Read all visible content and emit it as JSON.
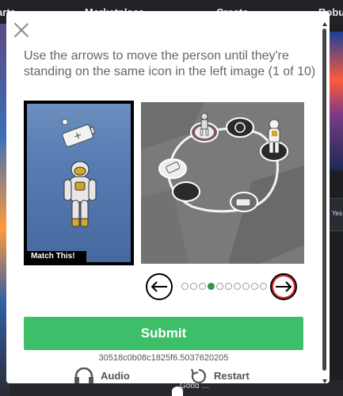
{
  "background": {
    "nav_items": [
      "arts",
      "Marketplace",
      "Create",
      "Robux"
    ],
    "right_text": "Yes",
    "bottom_text": "Good …"
  },
  "modal": {
    "instructions": "Use the arrows to move the person until they're standing on the same icon in the left image (1 of 10)",
    "target_label": "Match This!",
    "submit_label": "Submit",
    "session_id": "30518c0b08c1825f6.5037620205",
    "audio_label": "Audio",
    "restart_label": "Restart",
    "progress": {
      "current_page": 4,
      "total_pages": 10
    }
  },
  "colors": {
    "submit": "#3dbf6a",
    "active_dot": "#3d8f4a",
    "arrow_highlight": "#e02020"
  },
  "icons": [
    "close-icon",
    "left-arrow-icon",
    "right-arrow-icon",
    "headphones-icon",
    "restart-icon"
  ]
}
